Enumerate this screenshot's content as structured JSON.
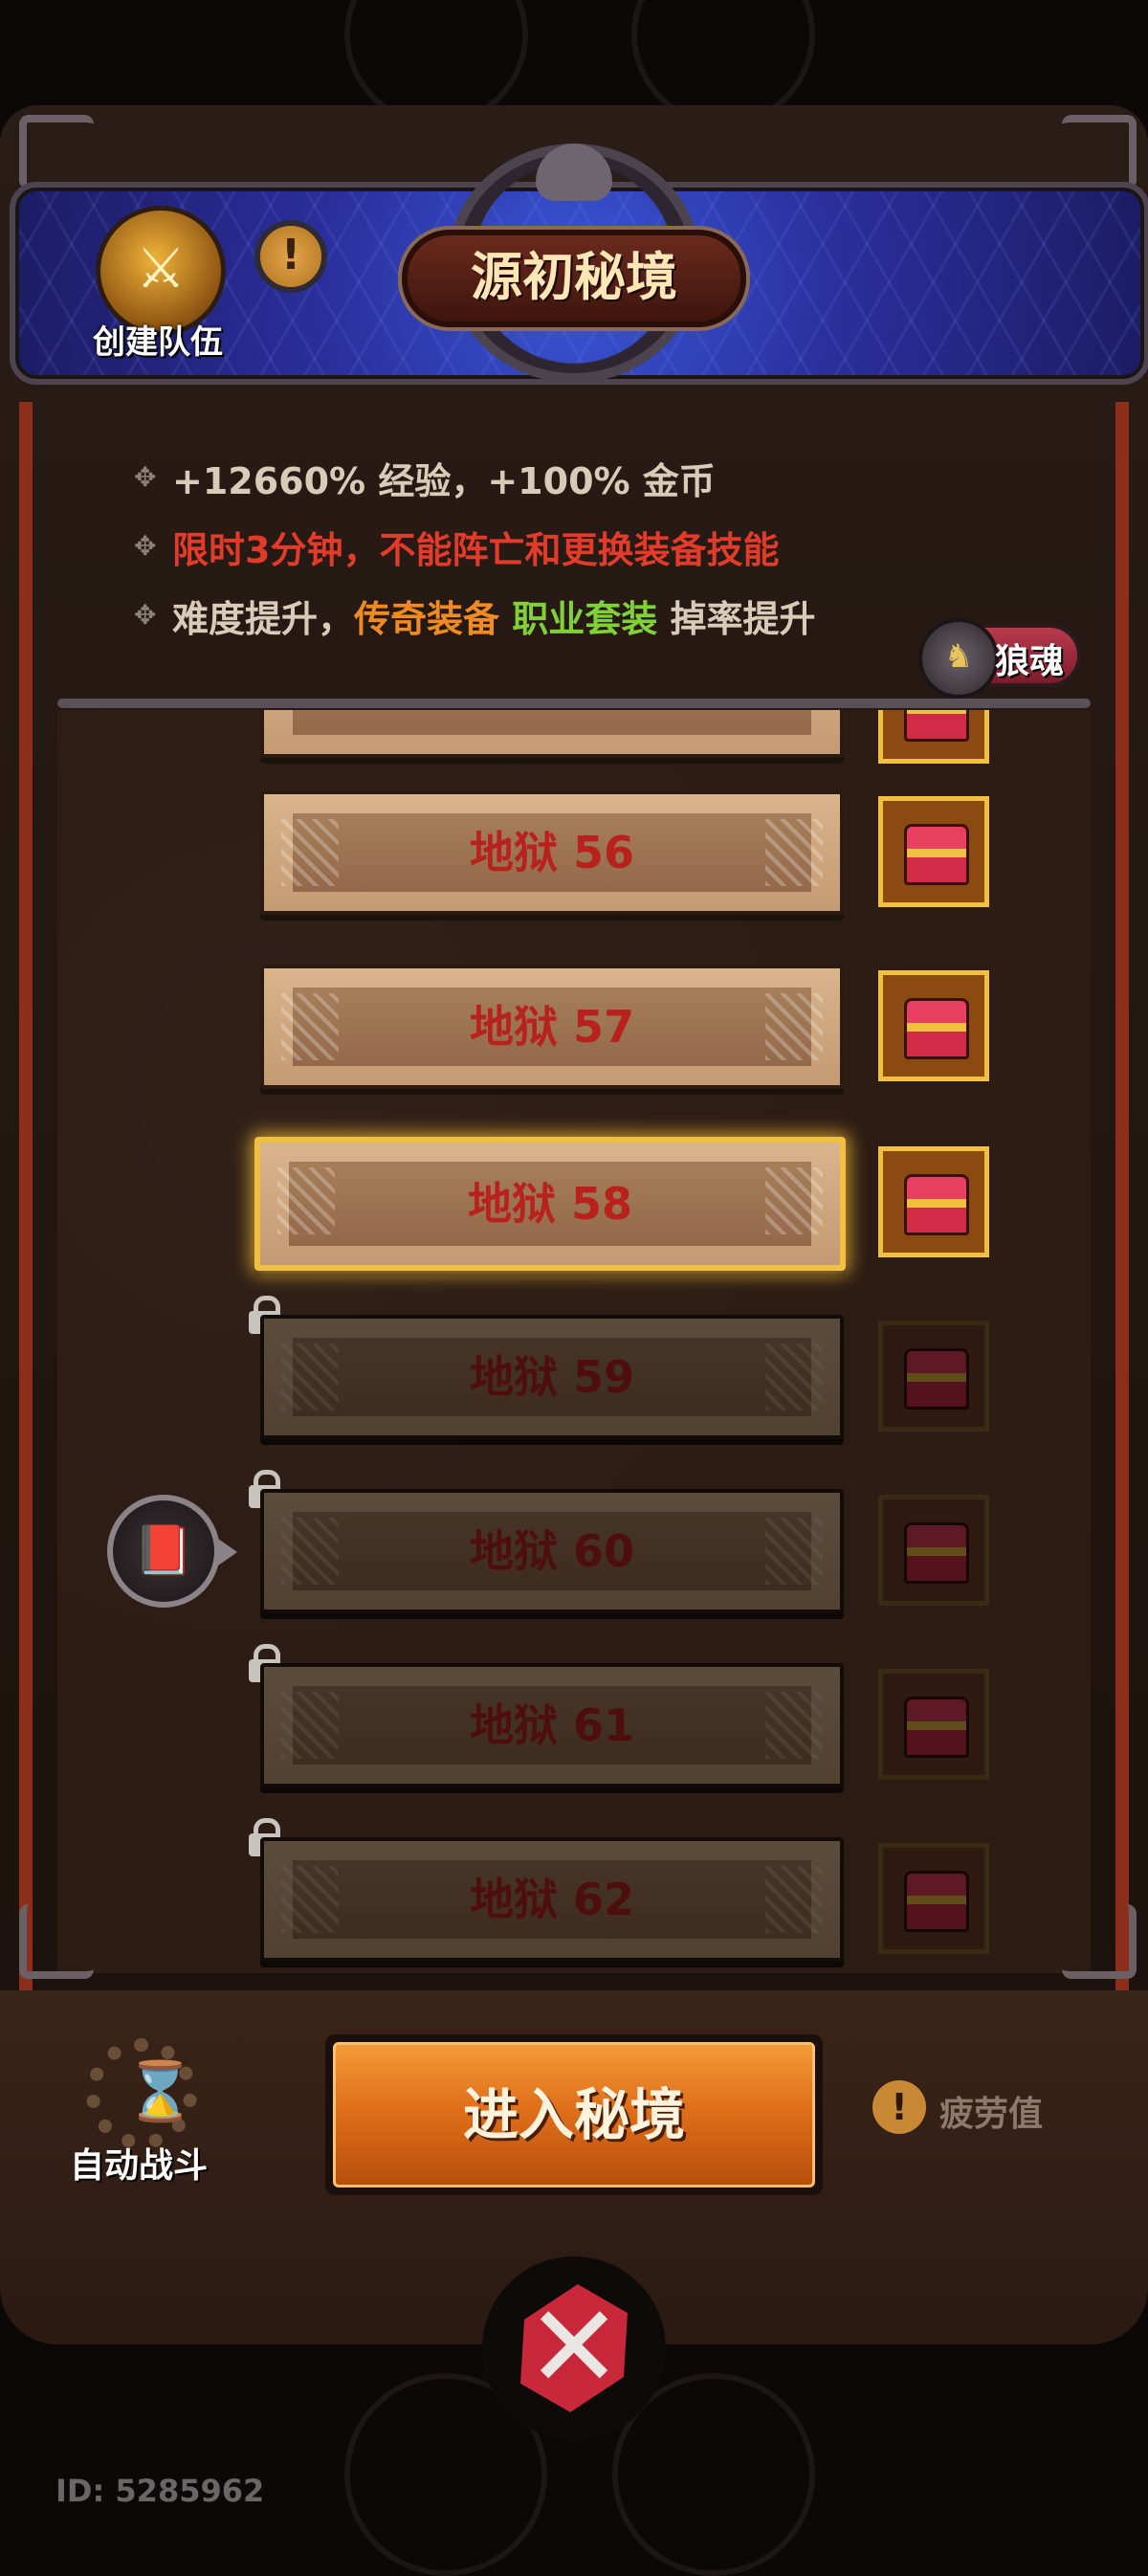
{
  "header": {
    "title": "源初秘境",
    "create_team_label": "创建队伍",
    "info_icon": "!"
  },
  "info": {
    "line1": "+12660% 经验，+100% 金币",
    "line2": "限时3分钟，不能阵亡和更换装备技能",
    "line3_prefix": "难度提升，",
    "line3_legendary": "传奇装备",
    "line3_set": "职业套装",
    "line3_suffix": "掉率提升",
    "wolf_soul_label": "狼魂"
  },
  "levels": [
    {
      "label": "地狱 56",
      "state": "unlocked"
    },
    {
      "label": "地狱 57",
      "state": "unlocked"
    },
    {
      "label": "地狱 58",
      "state": "selected"
    },
    {
      "label": "地狱 59",
      "state": "locked"
    },
    {
      "label": "地狱 60",
      "state": "locked"
    },
    {
      "label": "地狱 61",
      "state": "locked"
    },
    {
      "label": "地狱 62",
      "state": "locked"
    }
  ],
  "footer": {
    "auto_battle_label": "自动战斗",
    "enter_button_label": "进入秘境",
    "fatigue_label": "疲劳值",
    "fatigue_icon": "!"
  },
  "player_id": "ID: 5285962",
  "colors": {
    "accent_orange": "#e0701a",
    "legendary": "#f08a22",
    "set_green": "#80d138",
    "warning_red": "#e23b2a",
    "selected_gold": "#f2c041"
  }
}
